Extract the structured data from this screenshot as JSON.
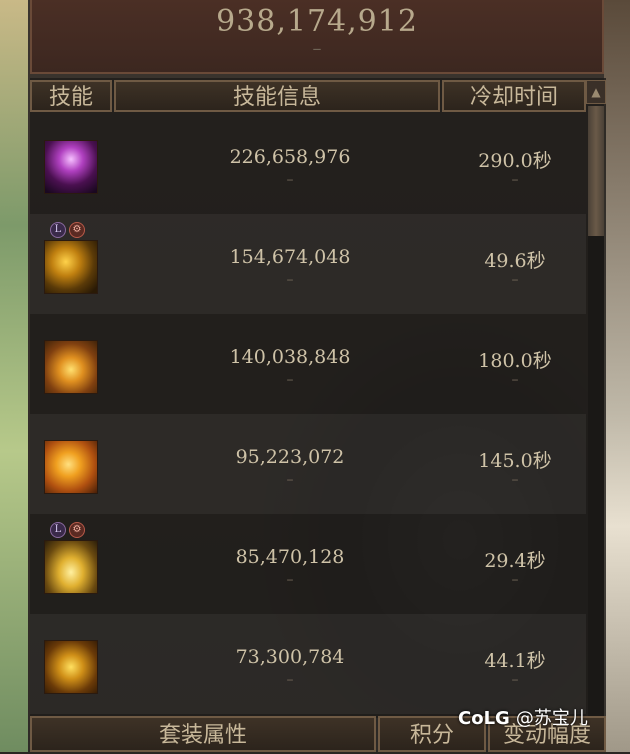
{
  "header": {
    "total_damage": "938,174,912",
    "total_dash": "–"
  },
  "table": {
    "columns": {
      "skill": "技能",
      "info": "技能信息",
      "cooldown": "冷却时间"
    },
    "rows": [
      {
        "damage": "226,658,976",
        "cooldown": "290.0秒",
        "icon": "dark-goddess-skill-icon",
        "badges": []
      },
      {
        "damage": "154,674,048",
        "cooldown": "49.6秒",
        "icon": "golden-burst-skill-icon",
        "badges": [
          "L",
          "gear"
        ]
      },
      {
        "damage": "140,038,848",
        "cooldown": "180.0秒",
        "icon": "golden-vortex-skill-icon",
        "badges": []
      },
      {
        "damage": "95,223,072",
        "cooldown": "145.0秒",
        "icon": "flame-blades-skill-icon",
        "badges": []
      },
      {
        "damage": "85,470,128",
        "cooldown": "29.4秒",
        "icon": "golden-ring-skill-icon",
        "badges": [
          "L",
          "gear"
        ]
      },
      {
        "damage": "73,300,784",
        "cooldown": "44.1秒",
        "icon": "golden-wings-skill-icon",
        "badges": []
      }
    ],
    "dash": "–"
  },
  "footer": {
    "tab_set": "套装属性",
    "tab_points": "积分",
    "tab_change": "变动幅度"
  },
  "watermark": {
    "logo": "CoLG",
    "user": "@苏宝儿"
  }
}
